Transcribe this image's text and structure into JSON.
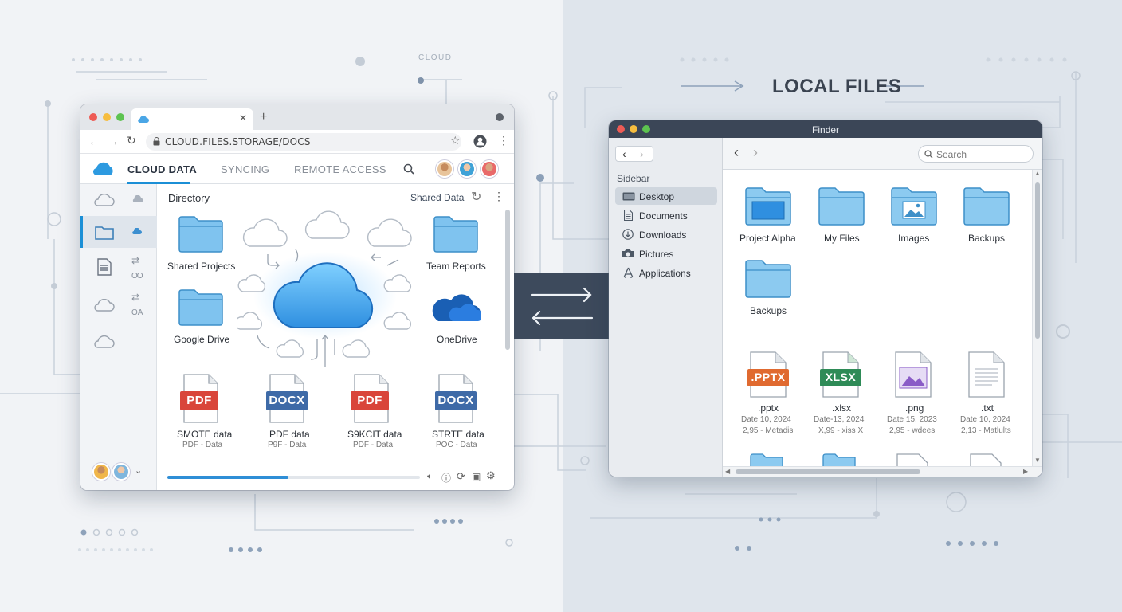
{
  "background": {
    "left_label": "CLOUD",
    "right_label": "LOCAL FILES"
  },
  "browser": {
    "url": "CLOUD.FILES.STORAGE/DOCS",
    "tabs": [
      "CLOUD DATA",
      "SYNCING",
      "REMOTE ACCESS"
    ],
    "section_title": "Directory",
    "shared_label": "Shared Data",
    "folders": [
      "Shared Projects",
      "Team Reports",
      "Google Drive",
      "OneDrive"
    ],
    "files": [
      {
        "badge": "PDF",
        "name": "SMOTE data",
        "meta": "PDF - Data"
      },
      {
        "badge": "DOCX",
        "name": "PDF data",
        "meta": "P9F - Data"
      },
      {
        "badge": "PDF",
        "name": "S9KCIT data",
        "meta": "PDF - Data"
      },
      {
        "badge": "DOCX",
        "name": "STRTE data",
        "meta": "POC - Data"
      }
    ],
    "progress": 0.48,
    "colors": {
      "pdf": "#d9453a",
      "docx": "#3e6aa7",
      "folder": "#5fb5e8",
      "accent": "#1b8fd6"
    }
  },
  "finder": {
    "title": "Finder",
    "sidebar_heading": "Sidebar",
    "sidebar_items": [
      "Desktop",
      "Documents",
      "Downloads",
      "Pictures",
      "Applications"
    ],
    "search_placeholder": "Search",
    "folders": [
      "Project Alpha",
      "My Files",
      "Images",
      "Backups",
      "Backups"
    ],
    "files": [
      {
        "badge": ".PPTX",
        "ext": ".pptx",
        "date": "Date 10, 2024",
        "meta": "2,95 - Metadis"
      },
      {
        "badge": "XLSX",
        "ext": ".xlsx",
        "date": "Date-13, 2024",
        "meta": "X,99 - xiss X"
      },
      {
        "badge": "",
        "ext": ".png",
        "date": "Date 15, 2023",
        "meta": "2,95 - wdees"
      },
      {
        "badge": "",
        "ext": ".txt",
        "date": "Date 10, 2024",
        "meta": "2,13 - Matlults"
      }
    ]
  }
}
